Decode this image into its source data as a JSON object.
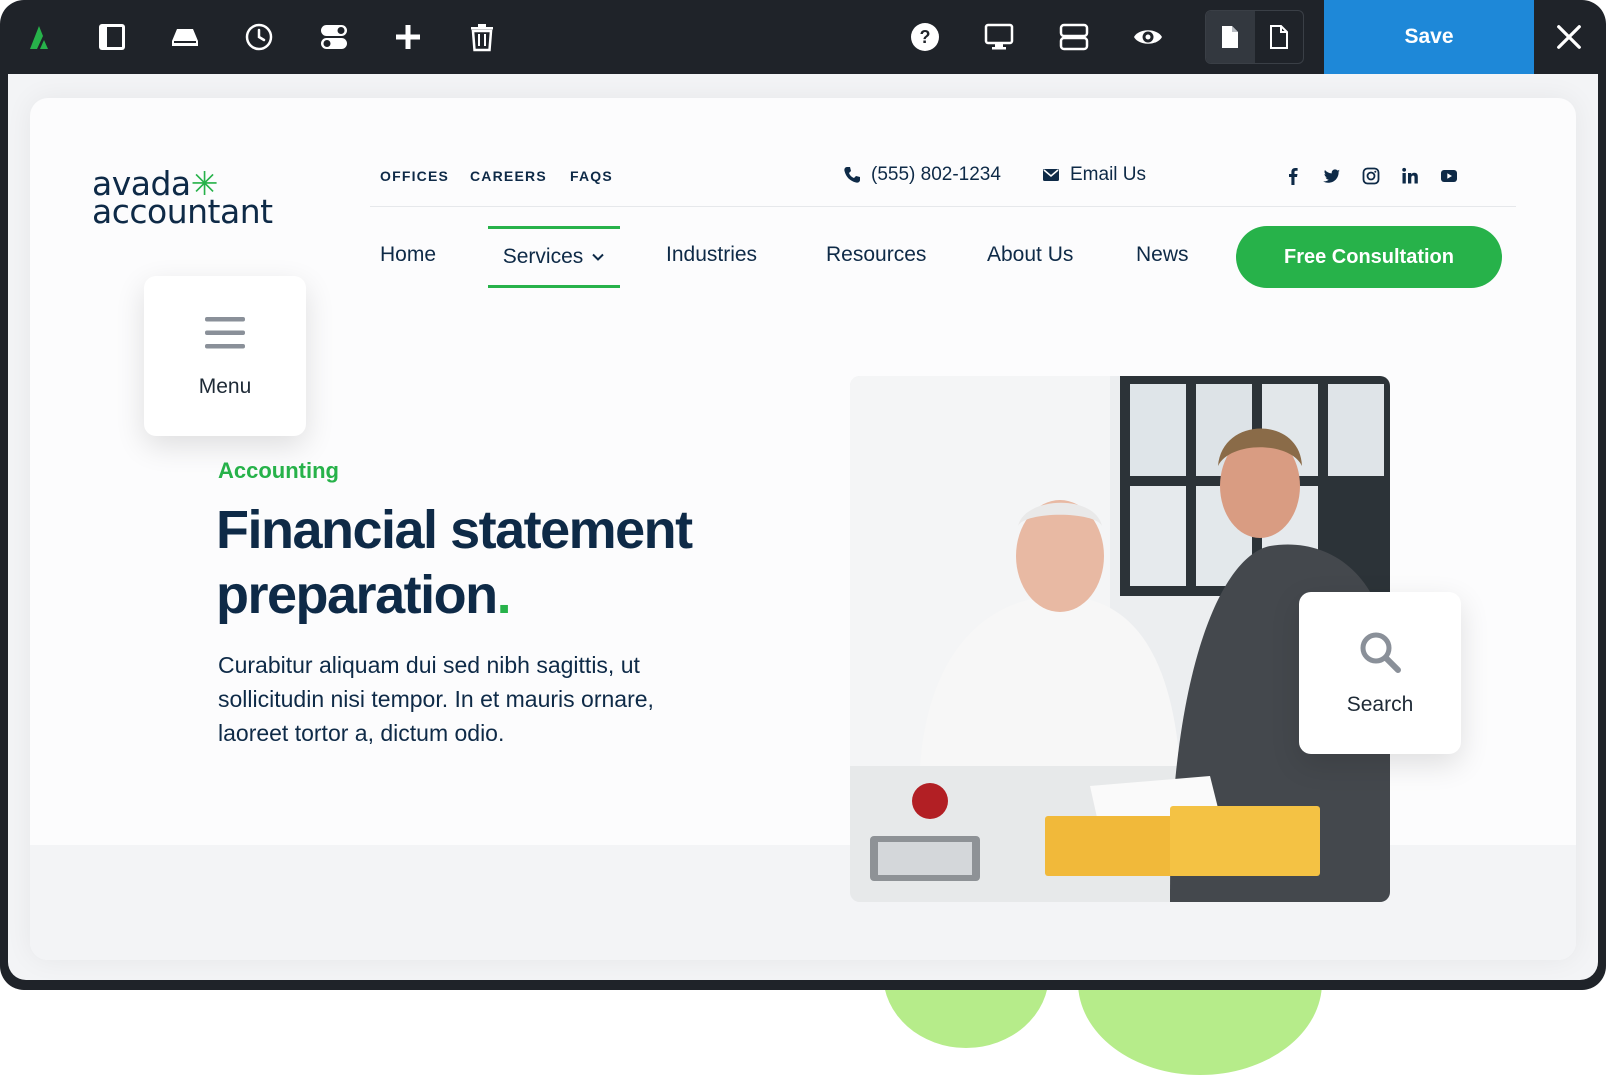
{
  "toolbar": {
    "icons": [
      "avada-logo-icon",
      "sidebar-icon",
      "library-icon",
      "history-icon",
      "toggle-icon",
      "plus-icon",
      "trash-icon",
      "help-icon",
      "desktop-icon",
      "layout-icon",
      "preview-icon"
    ],
    "save_label": "Save",
    "close_label": "✕"
  },
  "site": {
    "logo": {
      "line1": "avada",
      "star": "✳",
      "line2": "accountant"
    },
    "util_links": [
      "OFFICES",
      "CAREERS",
      "FAQS"
    ],
    "phone": "(555) 802-1234",
    "email": "Email Us",
    "socials": [
      "facebook-icon",
      "twitter-icon",
      "instagram-icon",
      "linkedin-icon",
      "youtube-icon"
    ],
    "nav": {
      "home": "Home",
      "services": "Services",
      "industries": "Industries",
      "resources": "Resources",
      "about": "About Us",
      "news": "News"
    },
    "cta": "Free Consultation",
    "menu_card": "Menu",
    "search_card": "Search"
  },
  "hero": {
    "kicker": "Accounting",
    "title_line1": "Financial statement",
    "title_line2": "preparation",
    "title_dot": ".",
    "body": "Curabitur aliquam dui sed nibh sagittis, ut sollicitudin nisi tempor. In et mauris ornare, laoreet tortor a, dictum odio."
  },
  "colors": {
    "accent_green": "#27b24a",
    "navy": "#0e2a47",
    "save_blue": "#1e88d8",
    "toolbar_dark": "#1f2329",
    "blob_green": "#b6ec8a"
  }
}
